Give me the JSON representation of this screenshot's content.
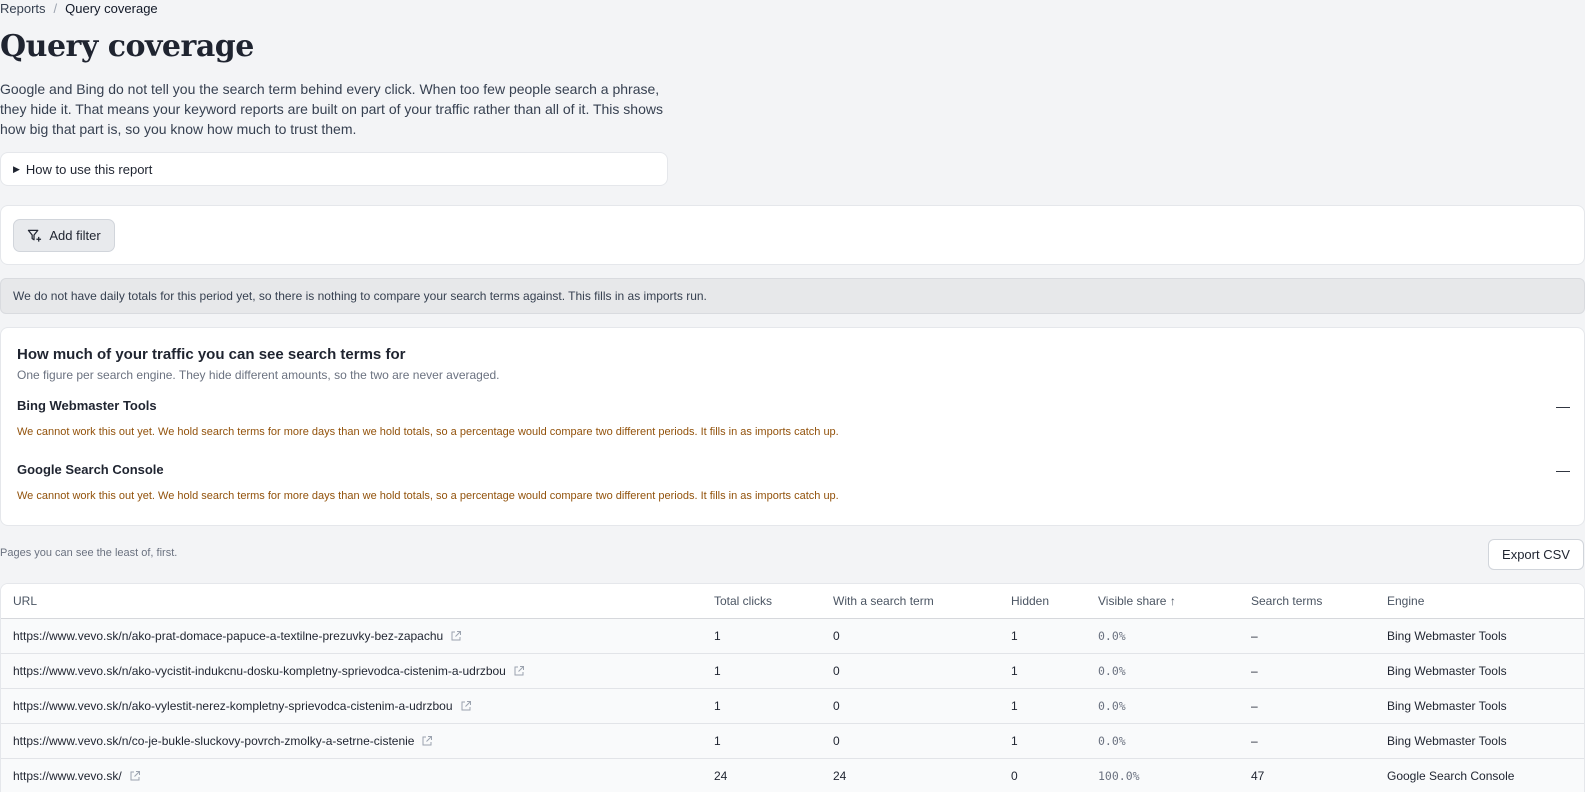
{
  "breadcrumb": {
    "root": "Reports",
    "separator": "/",
    "current": "Query coverage"
  },
  "page": {
    "title": "Query coverage",
    "intro": "Google and Bing do not tell you the search term behind every click. When too few people search a phrase, they hide it. That means your keyword reports are built on part of your traffic rather than all of it. This shows how big that part is, so you know how much to trust them.",
    "howto_label": "How to use this report"
  },
  "filters": {
    "add_label": "Add filter",
    "icon": "filter-plus-icon"
  },
  "notice": "We do not have daily totals for this period yet, so there is nothing to compare your search terms against. This fills in as imports run.",
  "coverage": {
    "title": "How much of your traffic you can see search terms for",
    "subtitle": "One figure per search engine. They hide different amounts, so the two are never averaged.",
    "engines": [
      {
        "name": "Bing Webmaster Tools",
        "value": "—",
        "warning": "We cannot work this out yet. We hold search terms for more days than we hold totals, so a percentage would compare two different periods. It fills in as imports catch up."
      },
      {
        "name": "Google Search Console",
        "value": "—",
        "warning": "We cannot work this out yet. We hold search terms for more days than we hold totals, so a percentage would compare two different periods. It fills in as imports catch up."
      }
    ]
  },
  "pages": {
    "note": "Pages you can see the least of, first.",
    "export_label": "Export CSV",
    "columns": [
      "URL",
      "Total clicks",
      "With a search term",
      "Hidden",
      "Visible share ↑",
      "Search terms",
      "Engine"
    ],
    "rows": [
      {
        "url": "https://www.vevo.sk/n/ako-prat-domace-papuce-a-textilne-prezuvky-bez-zapachu",
        "total": "1",
        "with_term": "0",
        "hidden": "1",
        "share": "0.0%",
        "terms": "–",
        "engine": "Bing Webmaster Tools"
      },
      {
        "url": "https://www.vevo.sk/n/ako-vycistit-indukcnu-dosku-kompletny-sprievodca-cistenim-a-udrzbou",
        "total": "1",
        "with_term": "0",
        "hidden": "1",
        "share": "0.0%",
        "terms": "–",
        "engine": "Bing Webmaster Tools"
      },
      {
        "url": "https://www.vevo.sk/n/ako-vylestit-nerez-kompletny-sprievodca-cistenim-a-udrzbou",
        "total": "1",
        "with_term": "0",
        "hidden": "1",
        "share": "0.0%",
        "terms": "–",
        "engine": "Bing Webmaster Tools"
      },
      {
        "url": "https://www.vevo.sk/n/co-je-bukle-sluckovy-povrch-zmolky-a-setrne-cistenie",
        "total": "1",
        "with_term": "0",
        "hidden": "1",
        "share": "0.0%",
        "terms": "–",
        "engine": "Bing Webmaster Tools"
      },
      {
        "url": "https://www.vevo.sk/",
        "total": "24",
        "with_term": "24",
        "hidden": "0",
        "share": "100.0%",
        "terms": "47",
        "engine": "Google Search Console"
      }
    ]
  }
}
